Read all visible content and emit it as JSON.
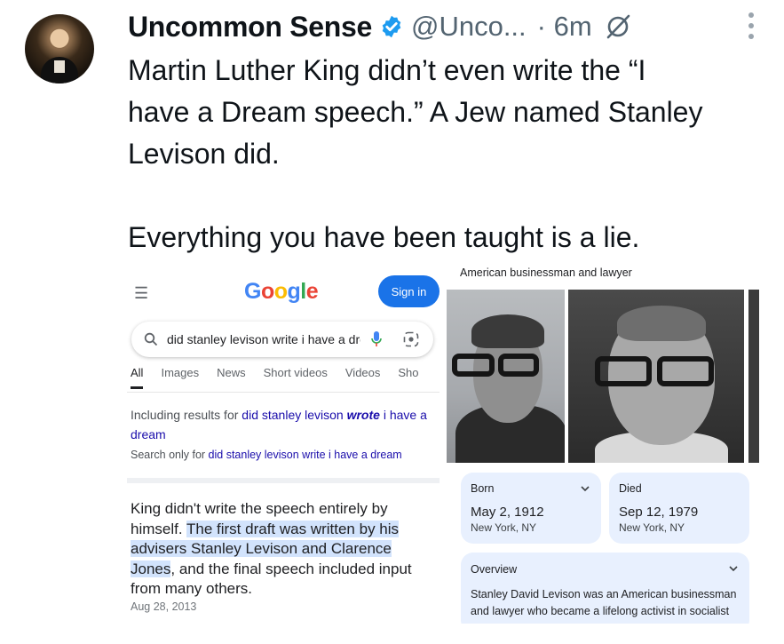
{
  "tweet": {
    "display_name": "Uncommon Sense",
    "handle": "@Unco...",
    "time": "· 6m",
    "text_lines": [
      "Martin Luther King didn’t even write the “I",
      "have a Dream speech.” A Jew named Stanley",
      "Levison did.",
      "Everything you have been taught is a lie."
    ],
    "colors": {
      "verified": "#1d9bf0",
      "secondary_text": "#536471"
    }
  },
  "google_screenshot": {
    "logo": "Google",
    "sign_in": "Sign in",
    "query": "did stanley levison write i have a dream",
    "tabs": [
      "All",
      "Images",
      "News",
      "Short videos",
      "Videos",
      "Sho"
    ],
    "including_prefix": "Including results for ",
    "including_link_a": "did stanley levison ",
    "including_link_bold": "wrote",
    "including_link_b": " i have a dream",
    "search_only_prefix": "Search only for ",
    "search_only_link": "did stanley levison write i have a dream",
    "snippet_plain_1": "King didn't write the speech entirely by himself. ",
    "snippet_highlight": "The first draft was written by his advisers Stanley Levison and Clarence Jones",
    "snippet_plain_2": ", and the final speech included input from many others.",
    "snippet_date": "Aug 28, 2013"
  },
  "knowledge_panel": {
    "subtitle": "American businessman and lawyer",
    "born_label": "Born",
    "born_date": "May 2, 1912",
    "born_place": "New York, NY",
    "died_label": "Died",
    "died_date": "Sep 12, 1979",
    "died_place": "New York, NY",
    "overview_label": "Overview",
    "overview_text": "Stanley David Levison was an American businessman and lawyer who became a lifelong activist in socialist"
  }
}
